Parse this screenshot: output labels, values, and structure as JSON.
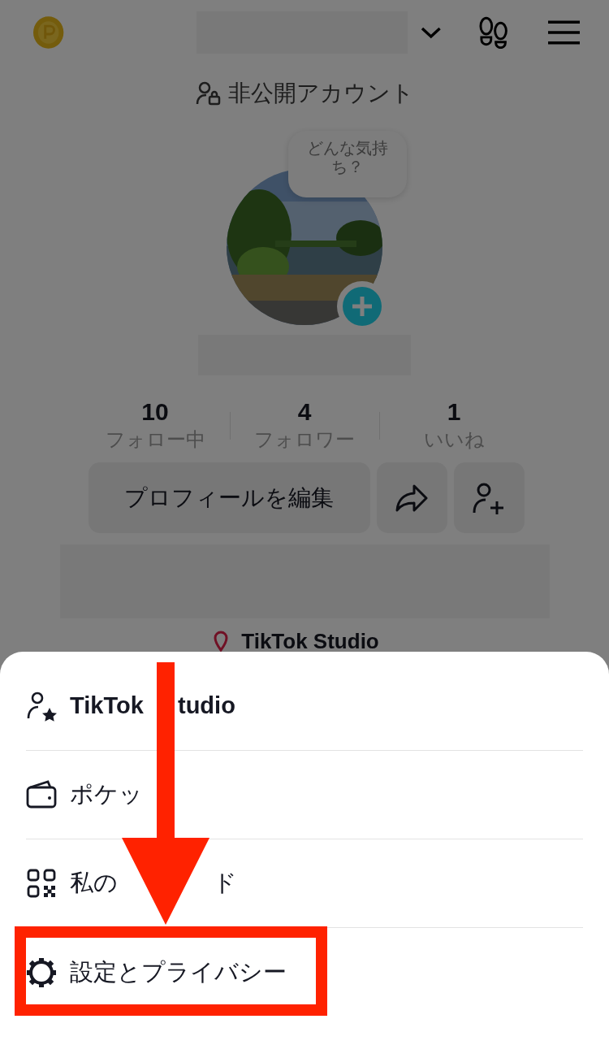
{
  "account": {
    "privacy_label": "非公開アカウント",
    "mood_bubble": "どんな気持ち？"
  },
  "stats": [
    {
      "value": "10",
      "label": "フォロー中"
    },
    {
      "value": "4",
      "label": "フォロワー"
    },
    {
      "value": "1",
      "label": "いいね"
    }
  ],
  "actions": {
    "edit_button": "プロフィールを編集"
  },
  "studio_link": "TikTok Studio",
  "menu": [
    {
      "kind": "studio",
      "label_parts": [
        "TikTok",
        "tudio"
      ],
      "highlighted": false
    },
    {
      "kind": "wallet",
      "label_parts": [
        "ポケッ"
      ],
      "highlighted": false
    },
    {
      "kind": "qr",
      "label_parts": [
        "私の",
        "ド"
      ],
      "highlighted": false
    },
    {
      "kind": "settings",
      "label_parts": [
        "設定とプライバシー"
      ],
      "highlighted": true
    }
  ]
}
